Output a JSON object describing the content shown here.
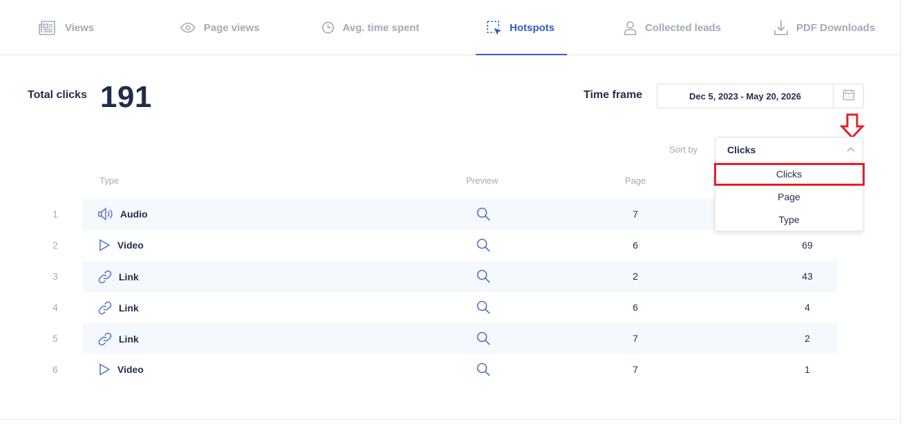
{
  "tabs": [
    {
      "label": "Views",
      "icon": "newspaper-icon",
      "active": false
    },
    {
      "label": "Page views",
      "icon": "eye-icon",
      "active": false
    },
    {
      "label": "Avg. time spent",
      "icon": "clock-icon",
      "active": false
    },
    {
      "label": "Hotspots",
      "icon": "hotspot-select-icon",
      "active": true
    },
    {
      "label": "Collected leads",
      "icon": "user-icon",
      "active": false
    },
    {
      "label": "PDF Downloads",
      "icon": "download-icon",
      "active": false
    }
  ],
  "summary": {
    "total_label": "Total clicks",
    "total_value": "191"
  },
  "timeframe": {
    "label": "Time frame",
    "value": "Dec 5, 2023 - May 20, 2026"
  },
  "sort": {
    "label": "Sort by",
    "selected": "Clicks",
    "options": [
      "Clicks",
      "Page",
      "Type"
    ]
  },
  "table": {
    "headers": {
      "type": "Type",
      "preview": "Preview",
      "page": "Page"
    },
    "rows": [
      {
        "num": "1",
        "type": "Audio",
        "icon": "speaker-icon",
        "page": "7",
        "clicks": ""
      },
      {
        "num": "2",
        "type": "Video",
        "icon": "play-icon",
        "page": "6",
        "clicks": "69"
      },
      {
        "num": "3",
        "type": "Link",
        "icon": "link-icon",
        "page": "2",
        "clicks": "43"
      },
      {
        "num": "4",
        "type": "Link",
        "icon": "link-icon",
        "page": "6",
        "clicks": "4"
      },
      {
        "num": "5",
        "type": "Link",
        "icon": "link-icon",
        "page": "7",
        "clicks": "2"
      },
      {
        "num": "6",
        "type": "Video",
        "icon": "play-icon",
        "page": "7",
        "clicks": "1"
      }
    ]
  },
  "colors": {
    "accent": "#2f5cc3",
    "muted": "#a2a9b6",
    "text": "#1f2d4a",
    "highlight": "#e0202a"
  }
}
